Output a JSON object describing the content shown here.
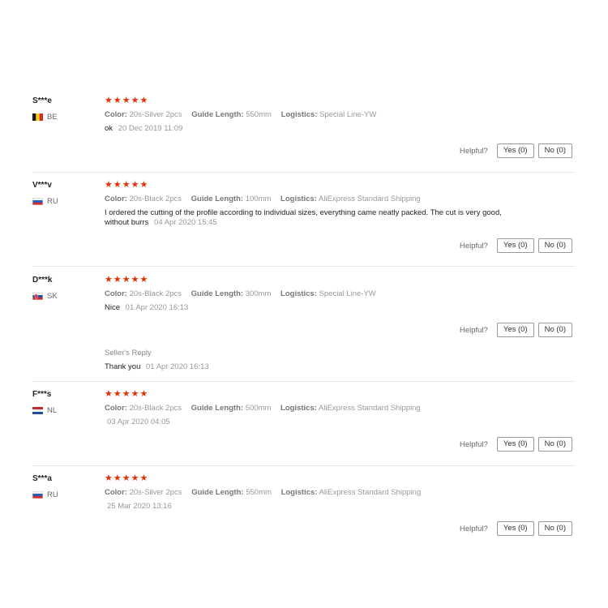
{
  "labels": {
    "color_key": "Color:",
    "guide_key": "Guide Length:",
    "logistics_key": "Logistics:",
    "helpful": "Helpful?",
    "seller_reply": "Seller's Reply",
    "stars": "★★★★★"
  },
  "reviews": [
    {
      "user": "S***e",
      "country": "BE",
      "flag": "be",
      "rating": 5,
      "color": "20s-Silver 2pcs",
      "guide_length": "550mm",
      "logistics": "Special Line-YW",
      "text": "ok",
      "date": "20 Dec 2019 11:09",
      "yes": "Yes (0)",
      "no": "No (0)"
    },
    {
      "user": "V***v",
      "country": "RU",
      "flag": "ru",
      "rating": 5,
      "color": "20s-Black 2pcs",
      "guide_length": "100mm",
      "logistics": "AliExpress Standard Shipping",
      "text": "I ordered the cutting of the profile according to individual sizes, everything came neatly packed. The cut is very good, without burrs",
      "date": "04 Apr 2020 15:45",
      "yes": "Yes (0)",
      "no": "No (0)"
    },
    {
      "user": "D***k",
      "country": "SK",
      "flag": "sk",
      "rating": 5,
      "color": "20s-Black 2pcs",
      "guide_length": "300mm",
      "logistics": "Special Line-YW",
      "text": "Nice",
      "date": "01 Apr 2020 16:13",
      "yes": "Yes (0)",
      "no": "No (0)",
      "seller_reply_text": "Thank you",
      "seller_reply_date": "01 Apr 2020 16:13"
    },
    {
      "user": "F***s",
      "country": "NL",
      "flag": "nl",
      "rating": 5,
      "color": "20s-Black 2pcs",
      "guide_length": "500mm",
      "logistics": "AliExpress Standard Shipping",
      "text": "",
      "date": "03 Apr 2020 04:05",
      "yes": "Yes (0)",
      "no": "No (0)"
    },
    {
      "user": "S***a",
      "country": "RU",
      "flag": "ru",
      "rating": 5,
      "color": "20s-Silver 2pcs",
      "guide_length": "550mm",
      "logistics": "AliExpress Standard Shipping",
      "text": "",
      "date": "25 Mar 2020 13:16",
      "yes": "Yes (0)",
      "no": "No (0)"
    }
  ]
}
